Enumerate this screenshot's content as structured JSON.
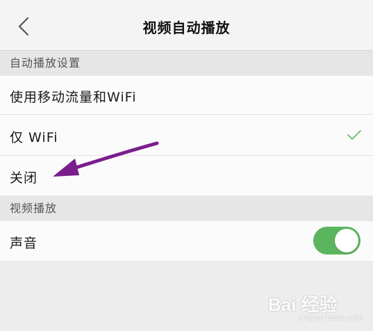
{
  "nav": {
    "title": "视频自动播放",
    "back_icon": "chevron-left-icon"
  },
  "autoplay_section": {
    "header": "自动播放设置",
    "options": [
      {
        "label": "使用移动流量和WiFi",
        "selected": false
      },
      {
        "label": "仅 WiFi",
        "selected": true
      },
      {
        "label": "关闭",
        "selected": false
      }
    ],
    "check_color": "#5bb55e"
  },
  "video_section": {
    "header": "视频播放",
    "sound_label": "声音",
    "sound_enabled": true,
    "toggle_color": "#5bb55e"
  },
  "annotation": {
    "arrow_color": "#7a1e8c"
  },
  "watermark": {
    "brand": "Bai 经验",
    "url": "jingyan.baidu.com"
  }
}
